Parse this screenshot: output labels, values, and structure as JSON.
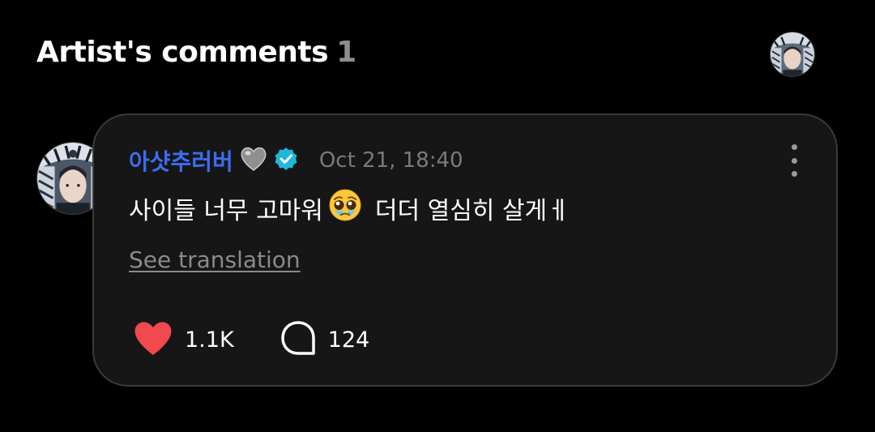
{
  "header": {
    "title": "Artist's comments",
    "count": "1"
  },
  "comment": {
    "username": "아샷추러버",
    "timestamp": "Oct 21, 18:40",
    "text_before_emoji": "사이들 너무 고마워",
    "text_after_emoji": "더더 열심히 살게ㅔ",
    "see_translation": "See translation",
    "likes": "1.1K",
    "replies": "124"
  },
  "icons": {
    "heart_emoji": "grey-heart-emoji",
    "verified": "verified-badge-icon",
    "emoji": "pleading-face-emoji",
    "like": "heart-icon",
    "reply": "speech-bubble-icon",
    "more": "more-vertical-icon"
  },
  "colors": {
    "background": "#000000",
    "card": "#161616",
    "username": "#3d6cf0",
    "verified": "#1fb8d8",
    "like_heart": "#f0494e",
    "muted_text": "#8a8a8a"
  }
}
